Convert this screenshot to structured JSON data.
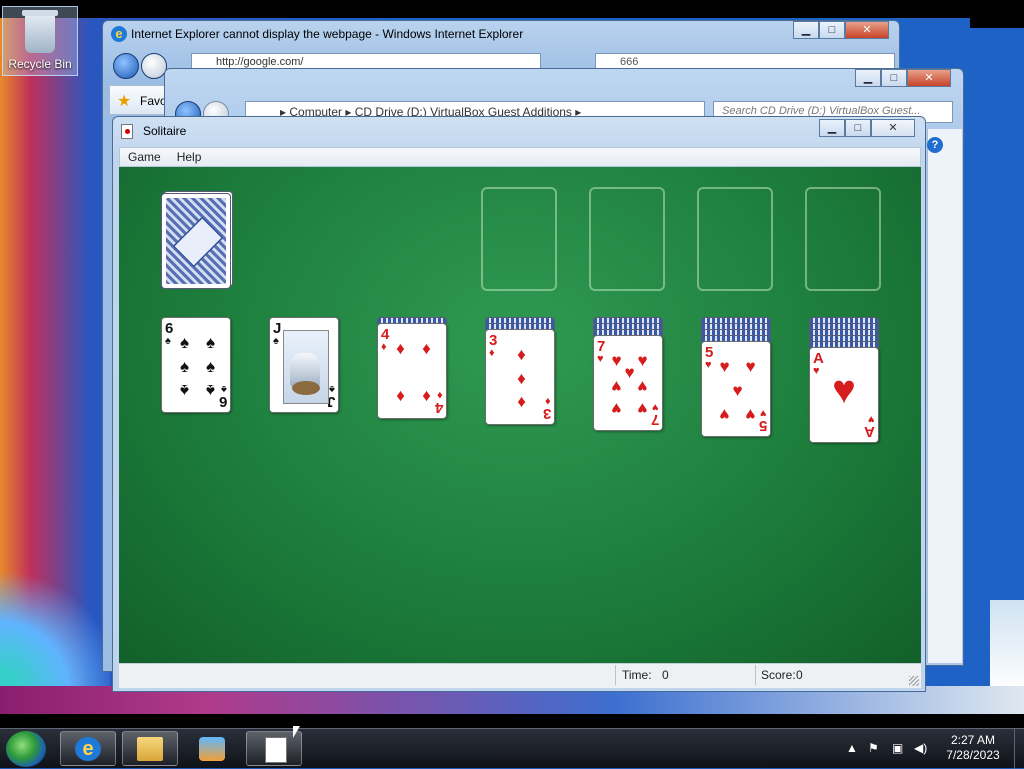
{
  "desktop": {
    "recycle_bin_label": "Recycle Bin"
  },
  "ie_window": {
    "title": "Internet Explorer cannot display the webpage - Windows Internet Explorer",
    "address": "http://google.com/",
    "search_value": "666",
    "favorites_label": "Favo"
  },
  "explorer_window": {
    "breadcrumb": "▸ Computer ▸ CD Drive (D:) VirtualBox Guest Additions ▸",
    "search_placeholder": "Search CD Drive (D:) VirtualBox Guest...",
    "help_icon": "?"
  },
  "solitaire": {
    "title": "Solitaire",
    "menu": [
      "Game",
      "Help"
    ],
    "time_label": "Time:",
    "time_value": "0",
    "score_label": "Score:",
    "score_value": "0",
    "tableau": [
      {
        "hidden": 0,
        "rank": "6",
        "suit": "♠",
        "color": "#111111"
      },
      {
        "hidden": 0,
        "rank": "J",
        "suit": "♠",
        "color": "#111111"
      },
      {
        "hidden": 1,
        "rank": "4",
        "suit": "♦",
        "color": "#d61c1c"
      },
      {
        "hidden": 2,
        "rank": "3",
        "suit": "♦",
        "color": "#d61c1c"
      },
      {
        "hidden": 3,
        "rank": "7",
        "suit": "♥",
        "color": "#d61c1c"
      },
      {
        "hidden": 4,
        "rank": "5",
        "suit": "♥",
        "color": "#d61c1c"
      },
      {
        "hidden": 5,
        "rank": "A",
        "suit": "♥",
        "color": "#d61c1c"
      }
    ]
  },
  "taskbar": {
    "time": "2:27 AM",
    "date": "7/28/2023",
    "apps": [
      "internet-explorer-icon",
      "windows-explorer-icon",
      "media-player-icon",
      "solitaire-icon"
    ]
  }
}
